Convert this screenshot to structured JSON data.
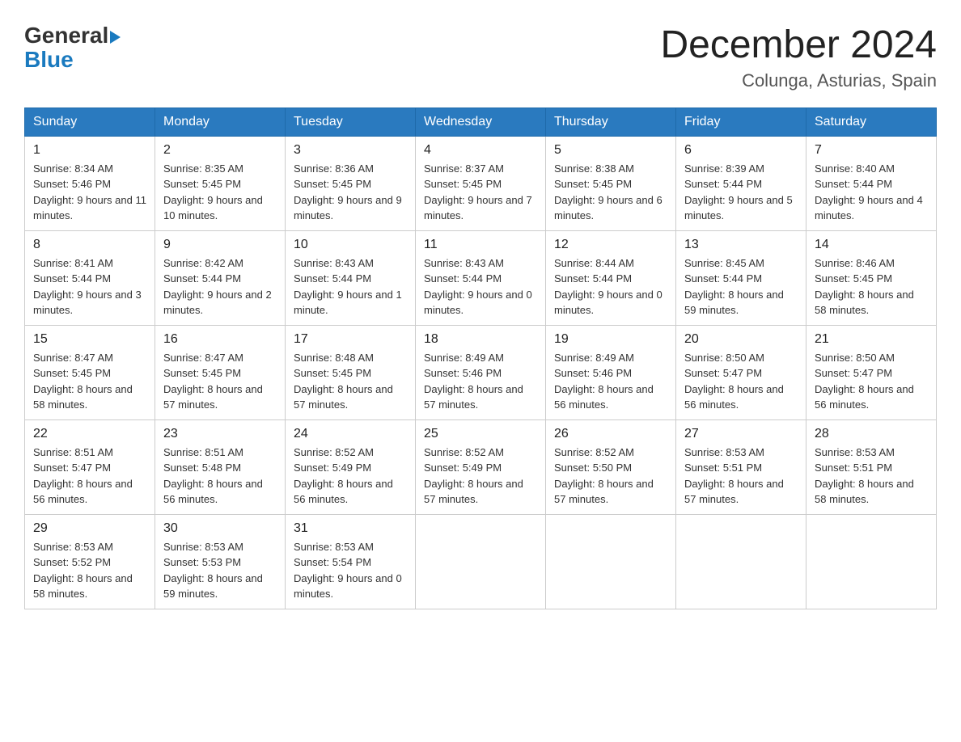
{
  "header": {
    "logo_general": "General",
    "logo_blue": "Blue",
    "month_title": "December 2024",
    "location": "Colunga, Asturias, Spain"
  },
  "days_of_week": [
    "Sunday",
    "Monday",
    "Tuesday",
    "Wednesday",
    "Thursday",
    "Friday",
    "Saturday"
  ],
  "weeks": [
    [
      {
        "day": "1",
        "sunrise": "8:34 AM",
        "sunset": "5:46 PM",
        "daylight": "9 hours and 11 minutes."
      },
      {
        "day": "2",
        "sunrise": "8:35 AM",
        "sunset": "5:45 PM",
        "daylight": "9 hours and 10 minutes."
      },
      {
        "day": "3",
        "sunrise": "8:36 AM",
        "sunset": "5:45 PM",
        "daylight": "9 hours and 9 minutes."
      },
      {
        "day": "4",
        "sunrise": "8:37 AM",
        "sunset": "5:45 PM",
        "daylight": "9 hours and 7 minutes."
      },
      {
        "day": "5",
        "sunrise": "8:38 AM",
        "sunset": "5:45 PM",
        "daylight": "9 hours and 6 minutes."
      },
      {
        "day": "6",
        "sunrise": "8:39 AM",
        "sunset": "5:44 PM",
        "daylight": "9 hours and 5 minutes."
      },
      {
        "day": "7",
        "sunrise": "8:40 AM",
        "sunset": "5:44 PM",
        "daylight": "9 hours and 4 minutes."
      }
    ],
    [
      {
        "day": "8",
        "sunrise": "8:41 AM",
        "sunset": "5:44 PM",
        "daylight": "9 hours and 3 minutes."
      },
      {
        "day": "9",
        "sunrise": "8:42 AM",
        "sunset": "5:44 PM",
        "daylight": "9 hours and 2 minutes."
      },
      {
        "day": "10",
        "sunrise": "8:43 AM",
        "sunset": "5:44 PM",
        "daylight": "9 hours and 1 minute."
      },
      {
        "day": "11",
        "sunrise": "8:43 AM",
        "sunset": "5:44 PM",
        "daylight": "9 hours and 0 minutes."
      },
      {
        "day": "12",
        "sunrise": "8:44 AM",
        "sunset": "5:44 PM",
        "daylight": "9 hours and 0 minutes."
      },
      {
        "day": "13",
        "sunrise": "8:45 AM",
        "sunset": "5:44 PM",
        "daylight": "8 hours and 59 minutes."
      },
      {
        "day": "14",
        "sunrise": "8:46 AM",
        "sunset": "5:45 PM",
        "daylight": "8 hours and 58 minutes."
      }
    ],
    [
      {
        "day": "15",
        "sunrise": "8:47 AM",
        "sunset": "5:45 PM",
        "daylight": "8 hours and 58 minutes."
      },
      {
        "day": "16",
        "sunrise": "8:47 AM",
        "sunset": "5:45 PM",
        "daylight": "8 hours and 57 minutes."
      },
      {
        "day": "17",
        "sunrise": "8:48 AM",
        "sunset": "5:45 PM",
        "daylight": "8 hours and 57 minutes."
      },
      {
        "day": "18",
        "sunrise": "8:49 AM",
        "sunset": "5:46 PM",
        "daylight": "8 hours and 57 minutes."
      },
      {
        "day": "19",
        "sunrise": "8:49 AM",
        "sunset": "5:46 PM",
        "daylight": "8 hours and 56 minutes."
      },
      {
        "day": "20",
        "sunrise": "8:50 AM",
        "sunset": "5:47 PM",
        "daylight": "8 hours and 56 minutes."
      },
      {
        "day": "21",
        "sunrise": "8:50 AM",
        "sunset": "5:47 PM",
        "daylight": "8 hours and 56 minutes."
      }
    ],
    [
      {
        "day": "22",
        "sunrise": "8:51 AM",
        "sunset": "5:47 PM",
        "daylight": "8 hours and 56 minutes."
      },
      {
        "day": "23",
        "sunrise": "8:51 AM",
        "sunset": "5:48 PM",
        "daylight": "8 hours and 56 minutes."
      },
      {
        "day": "24",
        "sunrise": "8:52 AM",
        "sunset": "5:49 PM",
        "daylight": "8 hours and 56 minutes."
      },
      {
        "day": "25",
        "sunrise": "8:52 AM",
        "sunset": "5:49 PM",
        "daylight": "8 hours and 57 minutes."
      },
      {
        "day": "26",
        "sunrise": "8:52 AM",
        "sunset": "5:50 PM",
        "daylight": "8 hours and 57 minutes."
      },
      {
        "day": "27",
        "sunrise": "8:53 AM",
        "sunset": "5:51 PM",
        "daylight": "8 hours and 57 minutes."
      },
      {
        "day": "28",
        "sunrise": "8:53 AM",
        "sunset": "5:51 PM",
        "daylight": "8 hours and 58 minutes."
      }
    ],
    [
      {
        "day": "29",
        "sunrise": "8:53 AM",
        "sunset": "5:52 PM",
        "daylight": "8 hours and 58 minutes."
      },
      {
        "day": "30",
        "sunrise": "8:53 AM",
        "sunset": "5:53 PM",
        "daylight": "8 hours and 59 minutes."
      },
      {
        "day": "31",
        "sunrise": "8:53 AM",
        "sunset": "5:54 PM",
        "daylight": "9 hours and 0 minutes."
      },
      null,
      null,
      null,
      null
    ]
  ],
  "labels": {
    "sunrise": "Sunrise:",
    "sunset": "Sunset:",
    "daylight": "Daylight:"
  }
}
